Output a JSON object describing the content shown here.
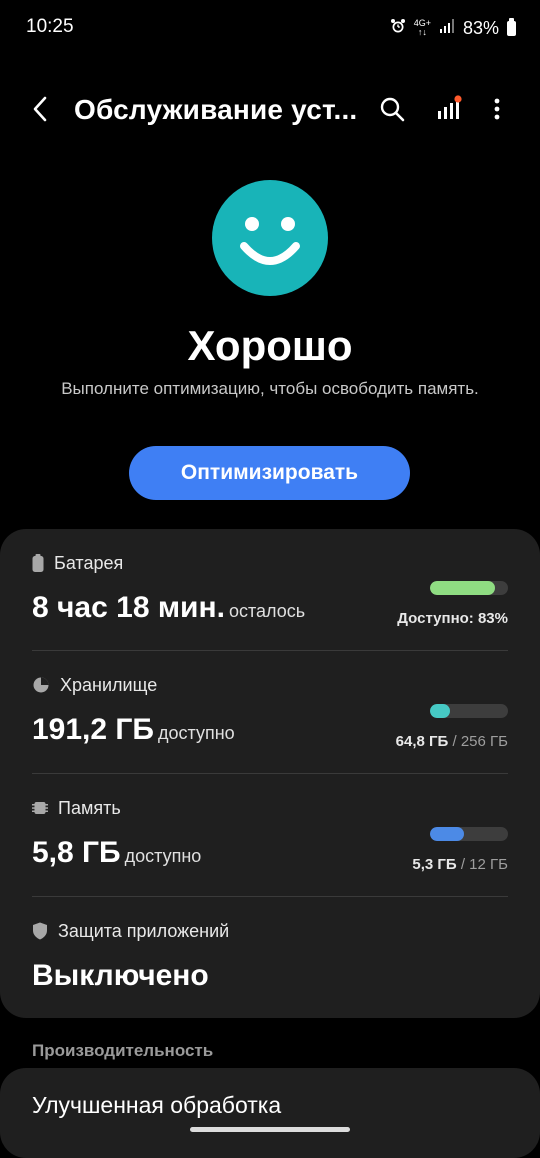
{
  "status_bar": {
    "time": "10:25",
    "network": "4G+",
    "battery": "83%"
  },
  "app_bar": {
    "title": "Обслуживание уст..."
  },
  "hero": {
    "status": "Хорошо",
    "subtitle": "Выполните оптимизацию, чтобы освободить память.",
    "button_label": "Оптимизировать",
    "face_color": "#18b4b8",
    "button_color": "#3f7ff4"
  },
  "battery": {
    "label": "Батарея",
    "value": "8 час 18 мин.",
    "suffix": "осталось",
    "detail": "Доступно: 83%",
    "fraction": 0.83,
    "color": "#8fdc82"
  },
  "storage": {
    "label": "Хранилище",
    "value": "191,2 ГБ",
    "suffix": "доступно",
    "used": "64,8 ГБ",
    "total": "/ 256 ГБ",
    "fraction": 0.253,
    "color": "#46c9c4"
  },
  "memory": {
    "label": "Память",
    "value": "5,8 ГБ",
    "suffix": "доступно",
    "used": "5,3 ГБ",
    "total": "/ 12 ГБ",
    "fraction": 0.44,
    "color": "#4c8ae6"
  },
  "app_protection": {
    "label": "Защита приложений",
    "value": "Выключено"
  },
  "performance": {
    "header": "Производительность",
    "item": "Улучшенная обработка"
  }
}
